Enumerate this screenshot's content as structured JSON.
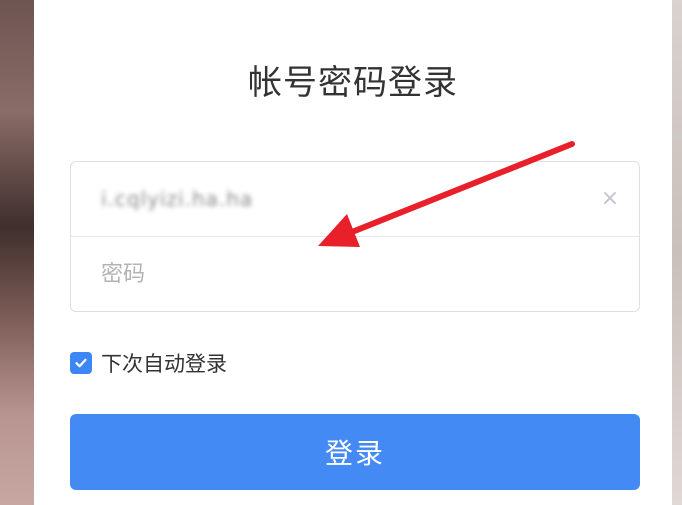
{
  "login": {
    "title": "帐号密码登录",
    "account_value": "i.cqlyizi.ha.ha",
    "password_placeholder": "密码",
    "clear_symbol": "×",
    "remember_label": "下次自动登录",
    "remember_checked": true,
    "submit_label": "登录"
  },
  "colors": {
    "accent": "#448af5",
    "annotation_arrow": "#e8202a"
  },
  "icons": {
    "clear": "close-icon",
    "checkbox": "checkmark-icon",
    "annotation": "red-arrow-icon"
  }
}
